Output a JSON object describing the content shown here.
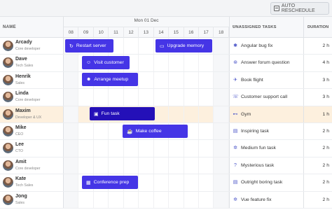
{
  "toolbar": {
    "auto_reschedule": "AUTO RESCHEDULE",
    "icon": "calendar-icon"
  },
  "headers": {
    "name": "NAME",
    "day": "Mon 01 Dec",
    "hours": [
      "08",
      "09",
      "10",
      "11",
      "12",
      "13",
      "14",
      "15",
      "16",
      "17",
      "18"
    ],
    "unassigned": "UNASSIGNED TASKS",
    "sort": "↑",
    "duration": "DURATION"
  },
  "people": [
    {
      "name": "Arcady",
      "role": "Core developer"
    },
    {
      "name": "Dave",
      "role": "Tech Sales"
    },
    {
      "name": "Henrik",
      "role": "Sales"
    },
    {
      "name": "Linda",
      "role": "Core developer"
    },
    {
      "name": "Maxim",
      "role": "Developer & UX"
    },
    {
      "name": "Mike",
      "role": "CEO"
    },
    {
      "name": "Lee",
      "role": "CTO"
    },
    {
      "name": "Amit",
      "role": "Core developer"
    },
    {
      "name": "Kate",
      "role": "Tech Sales"
    },
    {
      "name": "Jong",
      "role": "Sales"
    }
  ],
  "tasks": [
    {
      "icon": "bug-icon",
      "glyph": "✱",
      "name": "Angular bug fix",
      "duration": "2 h"
    },
    {
      "icon": "question-icon",
      "glyph": "⊛",
      "name": "Answer forum question",
      "duration": "4 h"
    },
    {
      "icon": "plane-icon",
      "glyph": "✈",
      "name": "Book flight",
      "duration": "3 h"
    },
    {
      "icon": "phone-icon",
      "glyph": "☏",
      "name": "Customer support call",
      "duration": "3 h"
    },
    {
      "icon": "dumbbell-icon",
      "glyph": "⊷",
      "name": "Gym",
      "duration": "1 h"
    },
    {
      "icon": "book-icon",
      "glyph": "▤",
      "name": "Inspiring task",
      "duration": "2 h"
    },
    {
      "icon": "gear-icon",
      "glyph": "✲",
      "name": "Medium fun task",
      "duration": "2 h"
    },
    {
      "icon": "question-mark-icon",
      "glyph": "?",
      "name": "Mysterious task",
      "duration": "2 h"
    },
    {
      "icon": "book-icon",
      "glyph": "▤",
      "name": "Outright boring task",
      "duration": "2 h"
    },
    {
      "icon": "gear-icon",
      "glyph": "✲",
      "name": "Vue feature fix",
      "duration": "2 h"
    }
  ],
  "events": {
    "restart_server": {
      "label": "Restart server",
      "icon": "refresh-icon",
      "glyph": "↻"
    },
    "upgrade_memory": {
      "label": "Upgrade memory",
      "icon": "laptop-icon",
      "glyph": "▭"
    },
    "visit_customer": {
      "label": "Visit customer",
      "icon": "user-icon",
      "glyph": "☺"
    },
    "arrange_meetup": {
      "label": "Arrange meetup",
      "icon": "users-icon",
      "glyph": "☻"
    },
    "fun_task": {
      "label": "Fun task",
      "icon": "gamepad-icon",
      "glyph": "▣"
    },
    "make_coffee": {
      "label": "Make coffee",
      "icon": "coffee-icon",
      "glyph": "☕"
    },
    "conference_prep": {
      "label": "Conference prep",
      "icon": "presentation-icon",
      "glyph": "▦"
    }
  }
}
